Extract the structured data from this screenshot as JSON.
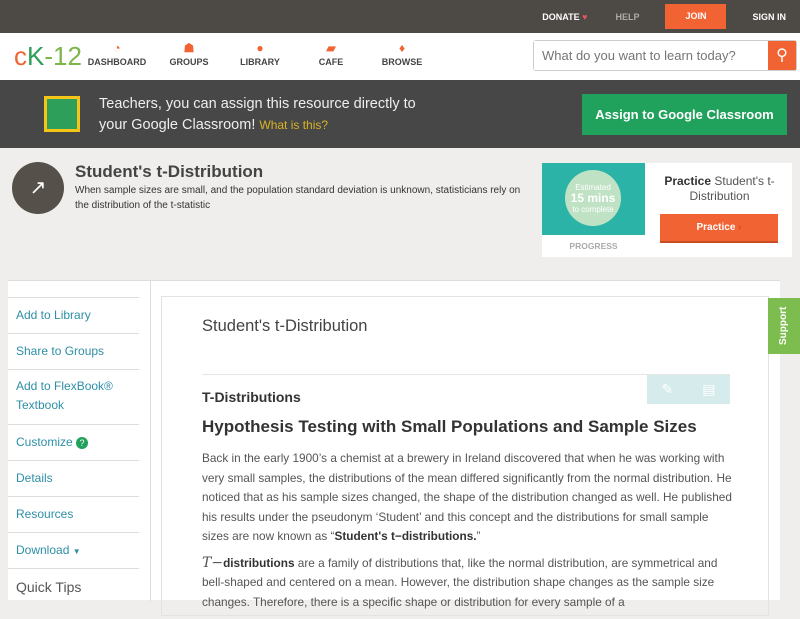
{
  "topbar": {
    "donate": "DONATE",
    "help": "HELP",
    "join": "JOIN",
    "signin": "SIGN IN"
  },
  "logo": {
    "c": "c",
    "k": "K",
    "rest": "-12"
  },
  "nav": [
    {
      "label": "DASHBOARD",
      "icon": "dashboard-icon"
    },
    {
      "label": "GROUPS",
      "icon": "groups-icon"
    },
    {
      "label": "LIBRARY",
      "icon": "library-icon"
    },
    {
      "label": "CAFE",
      "icon": "cafe-icon"
    },
    {
      "label": "BROWSE",
      "icon": "browse-icon"
    }
  ],
  "search": {
    "placeholder": "What do you want to learn today?"
  },
  "banner": {
    "text": "Teachers, you can assign this resource directly to your Google Classroom!",
    "link": "What is this?",
    "button": "Assign to Google Classroom"
  },
  "header": {
    "title": "Student's t-Distribution",
    "description": "When sample sizes are small, and the population standard deviation is unknown, statisticians rely on the distribution of the t-statistic"
  },
  "practice": {
    "estimated": "Estimated",
    "mins": "15 mins",
    "complete": "to complete",
    "progress": "PROGRESS",
    "title_bold": "Practice",
    "title_rest": "Student's t-Distribution",
    "button": "Practice"
  },
  "sidebar": {
    "items": [
      "Add to Library",
      "Share to Groups",
      "Add to FlexBook® Textbook",
      "Customize",
      "Details",
      "Resources",
      "Download"
    ],
    "quick_tips": "Quick Tips"
  },
  "content": {
    "title": "Student's t-Distribution",
    "subtitle": "T-Distributions",
    "heading": "Hypothesis Testing with Small Populations and Sample Sizes",
    "p1": "Back in the early 1900’s a chemist at a brewery in Ireland discovered that when he was working with very small samples, the distributions of the mean differed significantly from the normal distribution. He noticed that as his sample sizes changed, the shape of the distribution changed as well. He published his results under the pseudonym ‘Student’ and this concept and the distributions for small sample sizes are now known as “",
    "p1_bold": "Student's t−distributions.",
    "p1_end": "”",
    "p2_math": "T−",
    "p2_bold": "distributions",
    "p2": " are a family of distributions that, like the normal distribution, are symmetrical and bell-shaped and centered on a mean. However, the distribution shape changes as the sample size changes. Therefore, there is a specific shape or distribution for every sample of a"
  },
  "support": "Support",
  "colors": {
    "accent": "#f26334",
    "green": "#20a15c",
    "link": "#2e8fa6"
  }
}
